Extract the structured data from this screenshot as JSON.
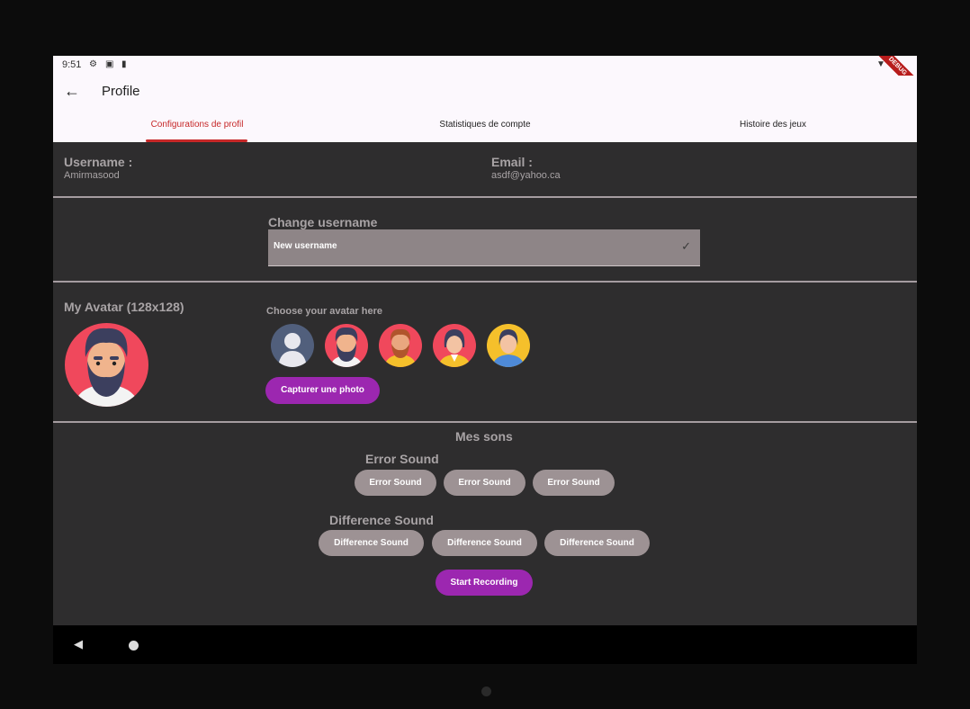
{
  "status": {
    "time": "9:51"
  },
  "appbar": {
    "title": "Profile"
  },
  "tabs": [
    {
      "label": "Configurations de profil"
    },
    {
      "label": "Statistiques de compte"
    },
    {
      "label": "Histoire des jeux"
    }
  ],
  "account": {
    "username_label": "Username :",
    "username_value": "Amirmasood",
    "email_label": "Email :",
    "email_value": "asdf@yahoo.ca"
  },
  "change_username": {
    "heading": "Change username",
    "input_value": "New username"
  },
  "avatar": {
    "heading": "My Avatar (128x128)",
    "choose_label": "Choose your avatar here",
    "capture_button": "Capturer une photo",
    "options": [
      "default-avatar",
      "bearded-man-avatar",
      "man-yellow-avatar",
      "woman-red-avatar",
      "woman-blue-avatar"
    ]
  },
  "sounds": {
    "heading": "Mes sons",
    "error_heading": "Error Sound",
    "error_buttons": [
      "Error Sound",
      "Error Sound",
      "Error Sound"
    ],
    "difference_heading": "Difference Sound",
    "difference_buttons": [
      "Difference Sound",
      "Difference Sound",
      "Difference Sound"
    ],
    "record_button": "Start Recording"
  },
  "colors": {
    "accent": "#9c27b0",
    "tab_active": "#c62828",
    "background": "#2e2d2e"
  }
}
